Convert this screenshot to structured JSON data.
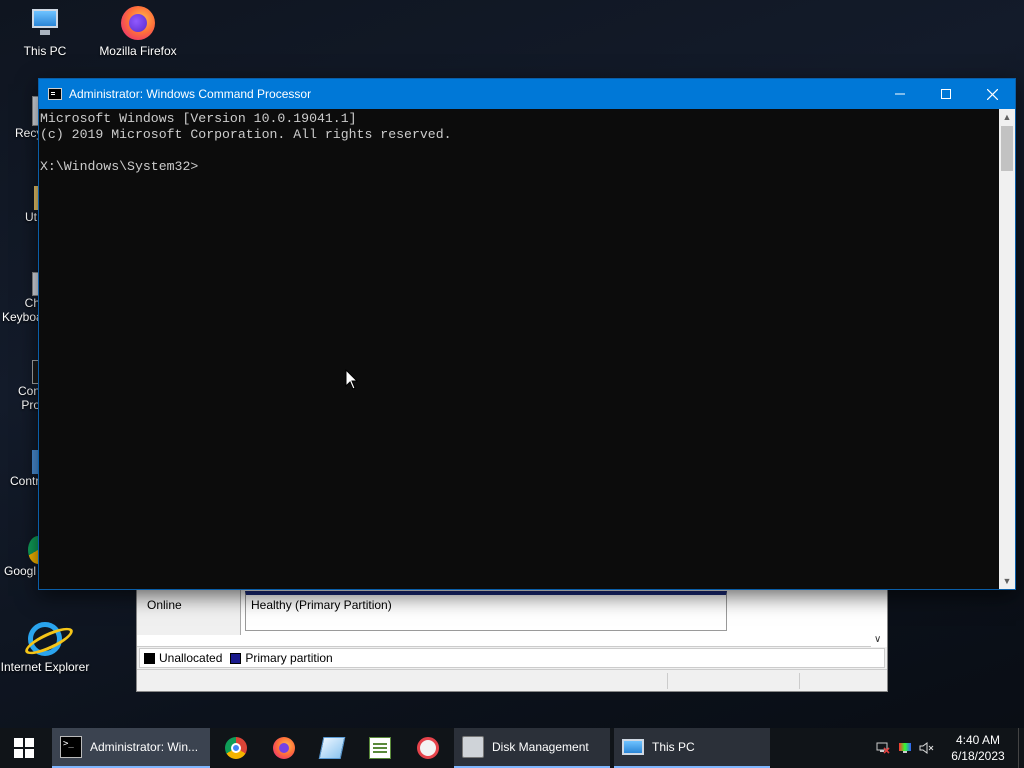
{
  "desktop": {
    "icons": [
      {
        "label": "This PC",
        "icon": "computer-icon"
      },
      {
        "label": "Mozilla Firefox",
        "icon": "firefox-icon"
      },
      {
        "label": "Internet Explorer",
        "icon": "internet-explorer-icon"
      }
    ],
    "partial_icons": [
      {
        "label": "Recy",
        "icon": "recycle-bin-icon"
      },
      {
        "label": "Ut",
        "icon": "utility-icon"
      },
      {
        "label": "Ch\nKeyboa",
        "icon": "keyboard-icon"
      },
      {
        "label": "Con\nPro",
        "icon": "command-prompt-icon"
      },
      {
        "label": "Contr",
        "icon": "control-panel-icon"
      },
      {
        "label": "Googl",
        "icon": "chrome-icon"
      }
    ]
  },
  "cmd_window": {
    "title": "Administrator: Windows Command Processor",
    "lines": [
      "Microsoft Windows [Version 10.0.19041.1]",
      "(c) 2019 Microsoft Corporation. All rights reserved.",
      "",
      "X:\\Windows\\System32>"
    ],
    "buttons": {
      "minimize": "minimize-icon",
      "maximize": "maximize-icon",
      "close": "close-icon"
    }
  },
  "disk_management": {
    "disk_status": "Online",
    "partition_status": "Healthy (Primary Partition)",
    "legend": [
      {
        "label": "Unallocated",
        "color": "#000000"
      },
      {
        "label": "Primary partition",
        "color": "#1a1a8c"
      }
    ]
  },
  "taskbar": {
    "start_icon": "windows-logo-icon",
    "items": [
      {
        "label": "Administrator: Win...",
        "icon": "cmd-icon",
        "state": "active"
      },
      {
        "label": "",
        "icon": "chrome-icon",
        "state": "pinned"
      },
      {
        "label": "",
        "icon": "firefox-icon",
        "state": "pinned"
      },
      {
        "label": "",
        "icon": "paper-icon",
        "state": "pinned"
      },
      {
        "label": "",
        "icon": "notepad-icon",
        "state": "pinned"
      },
      {
        "label": "",
        "icon": "snipping-tool-icon",
        "state": "pinned"
      },
      {
        "label": "Disk Management",
        "icon": "disk-management-icon",
        "state": "open"
      },
      {
        "label": "This PC",
        "icon": "this-pc-icon",
        "state": "open"
      }
    ],
    "clock": {
      "time": "4:40 AM",
      "date": "6/18/2023"
    }
  }
}
